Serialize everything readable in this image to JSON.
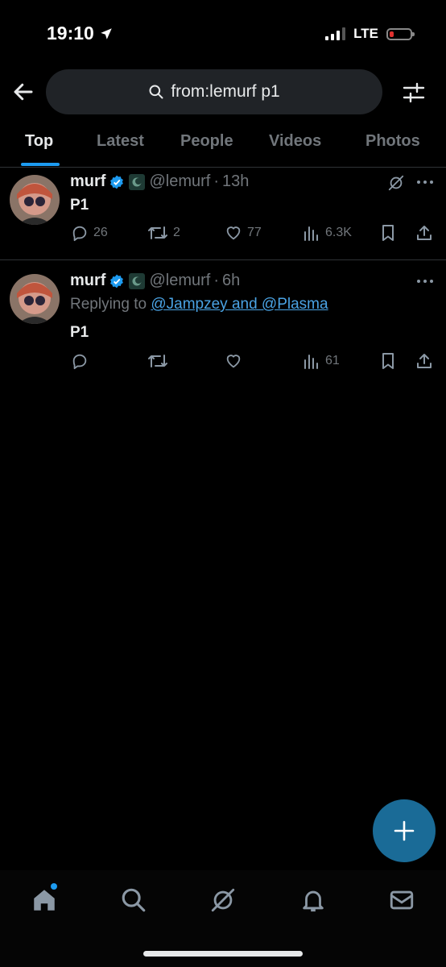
{
  "status_bar": {
    "time": "19:10",
    "network": "LTE",
    "battery_color": "#e0312f"
  },
  "header": {
    "search_query": "from:lemurf p1",
    "back_icon": "arrow-left-icon",
    "filter_icon": "sliders-icon"
  },
  "tabs": [
    {
      "label": "Top",
      "active": true
    },
    {
      "label": "Latest"
    },
    {
      "label": "People"
    },
    {
      "label": "Videos"
    },
    {
      "label": "Photos"
    }
  ],
  "tweets": [
    {
      "name": "murf",
      "handle": "@lemurf",
      "sep": "·",
      "time": "13h",
      "text": "P1",
      "replies": "26",
      "retweets": "2",
      "likes": "77",
      "views": "6.3K"
    },
    {
      "name": "murf",
      "handle": "@lemurf",
      "sep": "·",
      "time": "6h",
      "replying_prefix": "Replying to",
      "replying_to": "@Jampzey and @Plasma",
      "text": "P1",
      "views": "61"
    }
  ],
  "colors": {
    "accent": "#1d9bf0",
    "fab": "#1a6b97",
    "background": "#000000"
  }
}
